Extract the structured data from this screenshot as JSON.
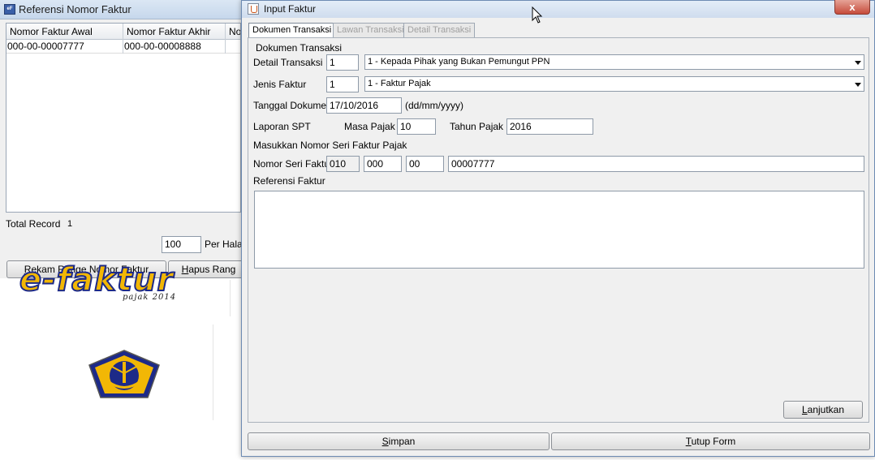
{
  "background_window": {
    "title": "Referensi Nomor Faktur",
    "columns": [
      "Nomor Faktur Awal",
      "Nomor Faktur Akhir",
      "No"
    ],
    "rows": [
      [
        "000-00-00007777",
        "000-00-00008888",
        ""
      ]
    ],
    "total_label": "Total Record",
    "total_value": "1",
    "per_page_value": "100",
    "per_page_label": "Per Hala",
    "buttons": {
      "rekam_prefix": "",
      "rekam_underline": "R",
      "rekam_rest": "ekam Range Nomor Faktur",
      "hapus_underline": "H",
      "hapus_rest": "apus Rang"
    }
  },
  "desktop": {
    "logo_text": "e-faktur",
    "logo_subtitle": "pajak 2014"
  },
  "dialog": {
    "title": "Input Faktur",
    "close_label": "x",
    "tabs": [
      {
        "label": "Dokumen Transaksi",
        "active": true
      },
      {
        "label": "Lawan Transaksi",
        "active": false
      },
      {
        "label": "Detail Transaksi",
        "active": false
      }
    ],
    "section_title": "Dokumen Transaksi",
    "detail_transaksi": {
      "label": "Detail Transaksi",
      "code": "1",
      "selected": "1 - Kepada Pihak yang Bukan Pemungut PPN"
    },
    "jenis_faktur": {
      "label": "Jenis Faktur",
      "code": "1",
      "selected": "1 - Faktur Pajak"
    },
    "tanggal_dokumen": {
      "label": "Tanggal Dokumen",
      "value": "17/10/2016",
      "format_hint": "(dd/mm/yyyy)"
    },
    "laporan_spt": {
      "label": "Laporan SPT",
      "masa_label": "Masa Pajak",
      "masa_value": "10",
      "tahun_label": "Tahun Pajak",
      "tahun_value": "2016"
    },
    "nomor_seri_heading": "Masukkan Nomor Seri Faktur Pajak",
    "nomor_seri": {
      "label": "Nomor Seri Faktur",
      "part1": "010",
      "part2": "000",
      "part3": "00",
      "part4": "00007777"
    },
    "referensi_label": "Referensi Faktur",
    "referensi_value": "",
    "buttons": {
      "lanjut_underline": "L",
      "lanjut_rest": "anjutkan",
      "simpan_underline": "S",
      "simpan_rest": "impan",
      "tutup_underline": "T",
      "tutup_rest": "utup Form"
    }
  },
  "colors": {
    "logo_yellow": "#f2b705",
    "logo_blue": "#1d2a88",
    "close_red": "#c54b3b"
  }
}
